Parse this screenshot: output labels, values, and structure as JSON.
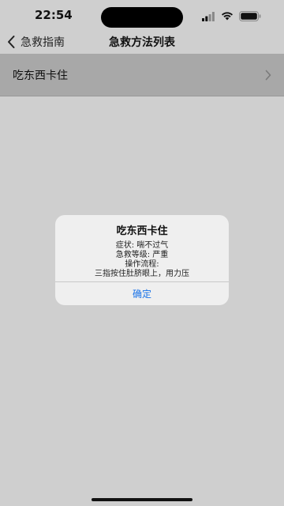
{
  "status_bar": {
    "time": "22:54"
  },
  "nav": {
    "back_label": "急救指南",
    "title": "急救方法列表"
  },
  "list": {
    "items": [
      {
        "label": "吃东西卡住"
      }
    ]
  },
  "alert": {
    "title": "吃东西卡住",
    "lines": [
      "症状: 喘不过气",
      "急救等级: 严重",
      "操作流程:",
      "三指按住肚脐眼上，用力压"
    ],
    "confirm_label": "确定"
  },
  "colors": {
    "accent": "#1a73e8",
    "row_background": "#a8a8a8",
    "page_background": "#cfcfcf"
  },
  "icons": [
    "back-chevron-icon",
    "row-chevron-icon",
    "signal-icon",
    "wifi-icon",
    "battery-icon"
  ]
}
